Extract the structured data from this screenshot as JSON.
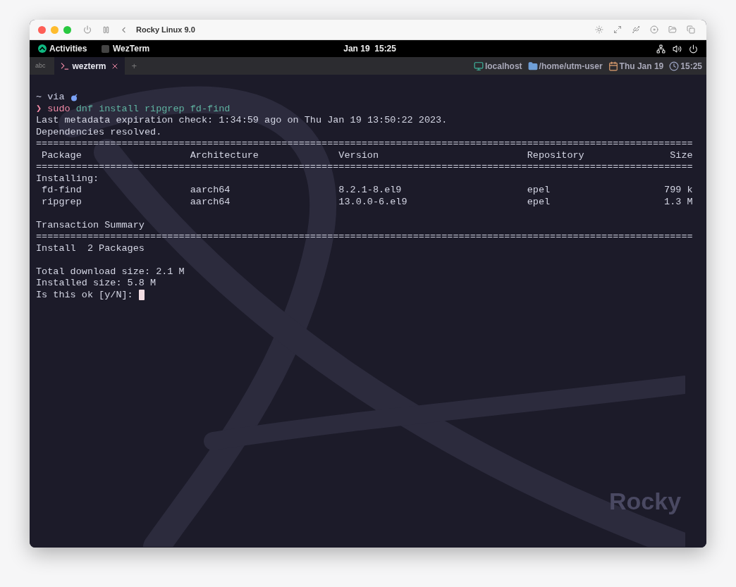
{
  "window": {
    "title": "Rocky Linux 9.0"
  },
  "top_bar": {
    "activities": "Activities",
    "app": "WezTerm",
    "clock": "Jan 19  15:25"
  },
  "tab_bar": {
    "left_label": "abc",
    "tabs": [
      {
        "label": "wezterm",
        "selected": true
      }
    ],
    "new_tab": "+",
    "status": [
      {
        "kind": "host",
        "text": "localhost"
      },
      {
        "kind": "dir",
        "text": "/home/utm-user"
      },
      {
        "kind": "date",
        "text": "Thu Jan 19"
      },
      {
        "kind": "time",
        "text": "15:25"
      }
    ]
  },
  "terminal": {
    "lines": [
      {
        "kind": "prompt",
        "dir": "~",
        "text": "via"
      },
      {
        "kind": "command",
        "symbol": "❯",
        "command": "sudo",
        "args": "dnf install ripgrep fd-find"
      },
      {
        "kind": "text",
        "text": "Last metadata expiration check: 1:34:59 ago on Thu Jan 19 13:50:22 2023."
      },
      {
        "kind": "text",
        "text": "Dependencies resolved."
      },
      {
        "kind": "rule",
        "text": "==================================================================================================================="
      },
      {
        "kind": "row",
        "cells": [
          "Package",
          "Architecture",
          "Version",
          "Repository",
          "Size"
        ]
      },
      {
        "kind": "rule",
        "text": "==================================================================================================================="
      },
      {
        "kind": "text",
        "text": "Installing:"
      },
      {
        "kind": "row",
        "cells": [
          "fd-find",
          "aarch64",
          "8.2.1-8.el9",
          "epel",
          "799 k"
        ]
      },
      {
        "kind": "row",
        "cells": [
          "ripgrep",
          "aarch64",
          "13.0.0-6.el9",
          "epel",
          "1.3 M"
        ]
      },
      {
        "kind": "blank"
      },
      {
        "kind": "text",
        "text": "Transaction Summary"
      },
      {
        "kind": "rule",
        "text": "==================================================================================================================="
      },
      {
        "kind": "text",
        "text": "Install  2 Packages"
      },
      {
        "kind": "blank"
      },
      {
        "kind": "text",
        "text": "Total download size: 2.1 M"
      },
      {
        "kind": "text",
        "text": "Installed size: 5.8 M"
      },
      {
        "kind": "input",
        "text": "Is this ok [y/N]:"
      }
    ],
    "wallpaper_text": "Rocky"
  }
}
